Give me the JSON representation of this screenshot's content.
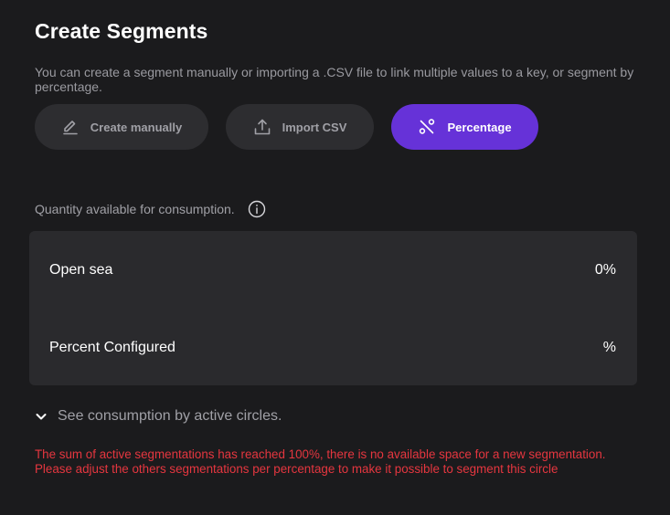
{
  "header": {
    "title": "Create Segments",
    "subtitle": "You can create a segment manually or importing a .CSV file to link multiple values to a key, or segment by percentage."
  },
  "buttons": {
    "create_manually": {
      "label": "Create manually",
      "icon": "pencil-icon"
    },
    "import_csv": {
      "label": "Import CSV",
      "icon": "upload-icon"
    },
    "percentage": {
      "label": "Percentage",
      "icon": "percent-icon"
    }
  },
  "quantity": {
    "label": "Quantity available for consumption.",
    "icon": "info-icon"
  },
  "panel": {
    "rows": [
      {
        "label": "Open sea",
        "value": "0%"
      },
      {
        "label": "Percent Configured",
        "value": "%"
      }
    ]
  },
  "consumption_toggle": {
    "label": "See consumption by active circles.",
    "icon": "chevron-down-icon"
  },
  "error": {
    "line1": "The sum of active segmentations has reached 100%, there is no available space for a new segmentation.",
    "line2": "Please adjust the others segmentations per percentage to make it possible to segment this circle"
  },
  "colors": {
    "background": "#1b1b1d",
    "panel": "#2a2a2d",
    "button_secondary": "#2d2d30",
    "accent": "#6632d8",
    "error": "#e5363f",
    "muted_text": "#a0a0a6"
  }
}
